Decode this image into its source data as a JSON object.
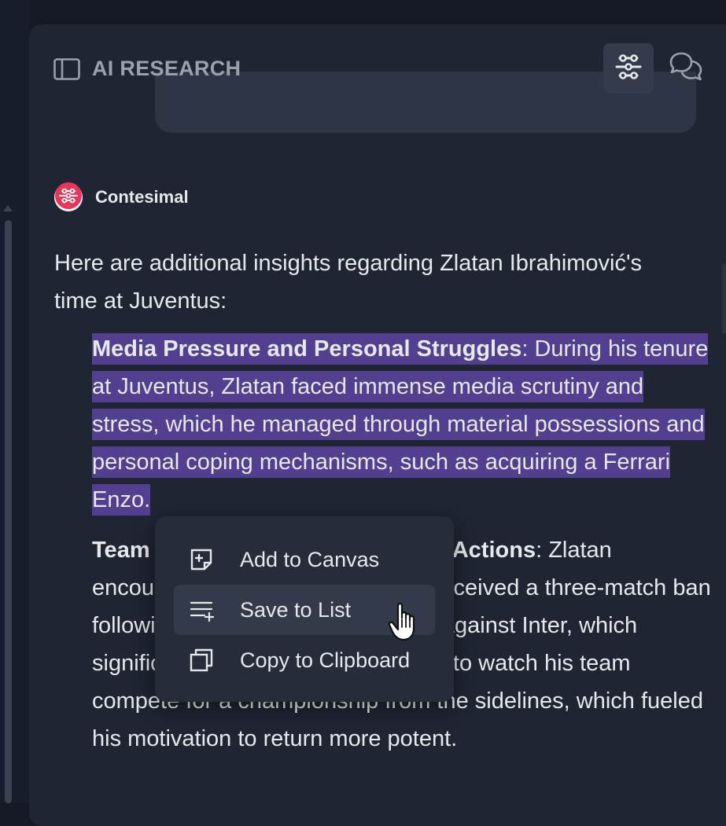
{
  "header": {
    "title": "AI RESEARCH",
    "icons": [
      "sidebar-toggle-icon",
      "flow-icon",
      "chat-bubbles-icon"
    ]
  },
  "assistant": {
    "name": "Contesimal",
    "avatar_color": "#e8365d"
  },
  "message": {
    "intro": "Here are additional insights regarding Zlatan Ibrahimović's time at Juventus:",
    "items": [
      {
        "title": "Media Pressure and Personal Struggles",
        "separator": ":",
        "body": " During his tenure at Juventus, Zlatan faced immense media scrutiny and stress, which he managed through material possessions and personal coping mechanisms, such as acquiring a Ferrari Enzo."
      },
      {
        "title": "Team Dynamics and Disciplinary Actions",
        "separator": ":",
        "body": " Zlatan encountered challenges when he received a three-match ban following an altercation in a match against Inter, which significantly affected him as he had to watch his team compete for a championship from the sidelines, which fueled his motivation to return more potent."
      }
    ]
  },
  "context_menu": {
    "items": [
      {
        "label": "Add to Canvas",
        "icon": "sticky-note-plus-icon"
      },
      {
        "label": "Save to List",
        "icon": "list-add-icon"
      },
      {
        "label": "Copy to Clipboard",
        "icon": "copy-icon"
      }
    ]
  },
  "colors": {
    "background": "#141925",
    "panel": "#1f2533",
    "selection_highlight": "#533f8f",
    "menu_background": "#262c3a",
    "menu_hover": "#333a4a"
  }
}
